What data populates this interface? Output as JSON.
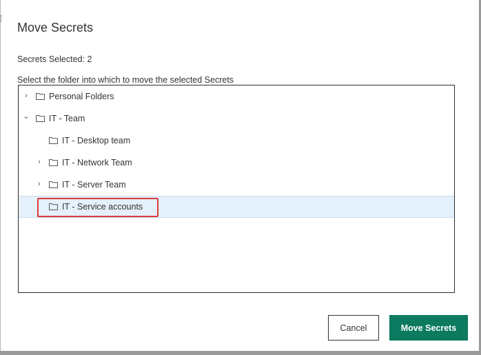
{
  "dialog": {
    "title": "Move Secrets",
    "selected_count_text": "Secrets Selected: 2",
    "instruction": "Select the folder into which to move the selected Secrets"
  },
  "tree": {
    "nodes": [
      {
        "label": "Personal Folders",
        "expand_state": "collapsed",
        "depth": 0,
        "selected": false
      },
      {
        "label": "IT - Team",
        "expand_state": "expanded",
        "depth": 0,
        "selected": false
      },
      {
        "label": "IT - Desktop team",
        "expand_state": "none",
        "depth": 1,
        "selected": false
      },
      {
        "label": "IT - Network Team",
        "expand_state": "collapsed",
        "depth": 1,
        "selected": false
      },
      {
        "label": "IT - Server Team",
        "expand_state": "collapsed",
        "depth": 1,
        "selected": false
      },
      {
        "label": "IT - Service accounts",
        "expand_state": "none",
        "depth": 1,
        "selected": true
      }
    ]
  },
  "icons": {
    "chevron_collapsed": "›",
    "chevron_expanded": "⌄"
  },
  "buttons": {
    "cancel_label": "Cancel",
    "move_label": "Move Secrets"
  },
  "colors": {
    "primary": "#0b7a5e",
    "selection": "#e4f0fb",
    "highlight": "#e0393c"
  }
}
